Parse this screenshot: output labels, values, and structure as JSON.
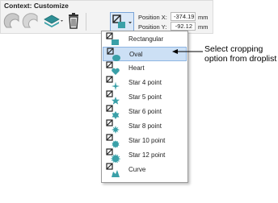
{
  "toolbar": {
    "context_title": "Context: Customize",
    "position_x_label": "Position X:",
    "position_x_value": "-374.19",
    "position_y_label": "Position Y:",
    "position_y_value": "-92.12",
    "unit": "mm"
  },
  "dropdown": {
    "items": [
      {
        "label": "Rectangular",
        "icon": "rectangle-crop-icon"
      },
      {
        "label": "Oval",
        "icon": "oval-crop-icon"
      },
      {
        "label": "Heart",
        "icon": "heart-crop-icon"
      },
      {
        "label": "Star 4 point",
        "icon": "star4-crop-icon"
      },
      {
        "label": "Star 5 point",
        "icon": "star5-crop-icon"
      },
      {
        "label": "Star 6 point",
        "icon": "star6-crop-icon"
      },
      {
        "label": "Star 8 point",
        "icon": "star8-crop-icon"
      },
      {
        "label": "Star 10 point",
        "icon": "star10-crop-icon"
      },
      {
        "label": "Star 12 point",
        "icon": "star12-crop-icon"
      },
      {
        "label": "Curve",
        "icon": "curve-crop-icon"
      }
    ],
    "selected": "Oval"
  },
  "callout": {
    "line1": "Select cropping",
    "line2": "option from droplist"
  },
  "colors": {
    "icon_teal": "#3aa0a8",
    "selection": "#cce0f5"
  }
}
